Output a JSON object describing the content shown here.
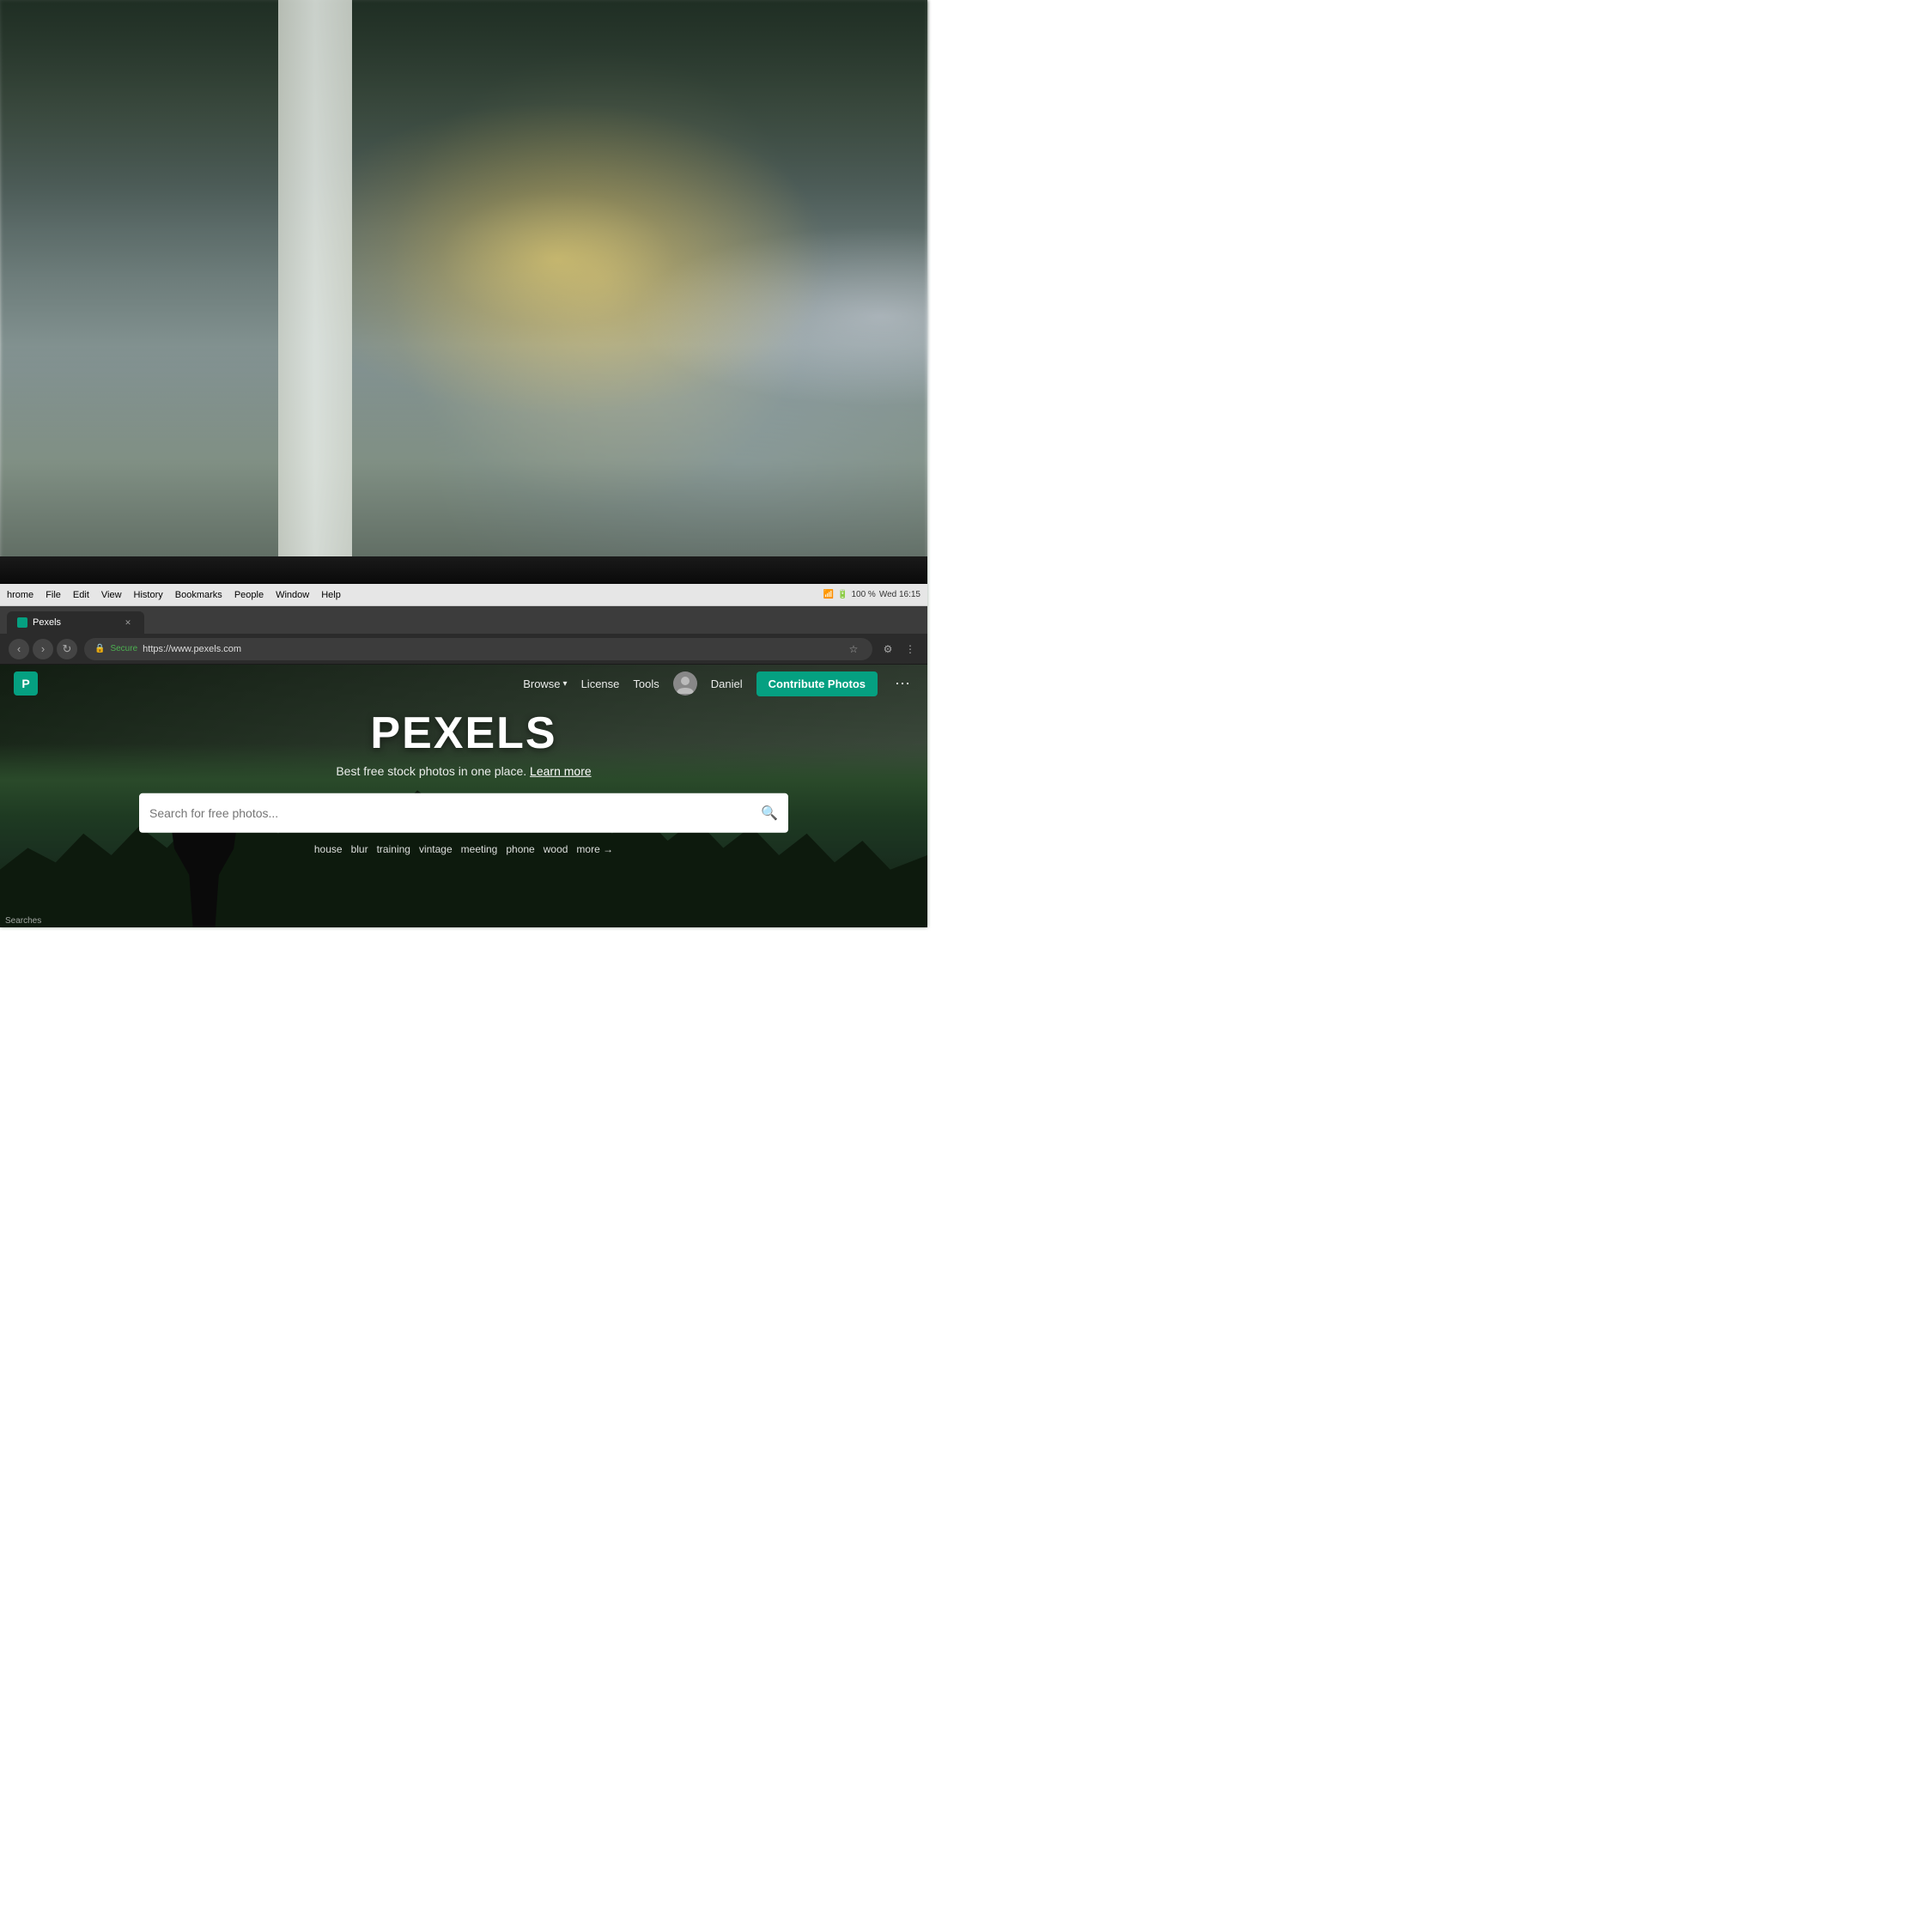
{
  "background": {
    "description": "Office interior with bokeh, column visible"
  },
  "menu_bar": {
    "app_name": "hrome",
    "items": [
      "File",
      "Edit",
      "View",
      "History",
      "Bookmarks",
      "People",
      "Window",
      "Help"
    ],
    "time": "Wed 16:15",
    "battery": "100 %"
  },
  "tab_bar": {
    "active_tab": {
      "title": "Pexels",
      "favicon": "P",
      "url": "https://www.pexels.com"
    }
  },
  "address_bar": {
    "secure_label": "Secure",
    "url": "https://www.pexels.com",
    "lock_icon": "🔒"
  },
  "pexels": {
    "nav": {
      "browse_label": "Browse",
      "license_label": "License",
      "tools_label": "Tools",
      "user_name": "Daniel",
      "contribute_label": "Contribute Photos",
      "more_icon": "⋯"
    },
    "hero": {
      "title": "PEXELS",
      "subtitle": "Best free stock photos in one place.",
      "learn_more": "Learn more",
      "search_placeholder": "Search for free photos...",
      "quick_searches": [
        "house",
        "blur",
        "training",
        "vintage",
        "meeting",
        "phone",
        "wood"
      ],
      "more_label": "more →"
    }
  },
  "bottom": {
    "searches_label": "Searches"
  }
}
